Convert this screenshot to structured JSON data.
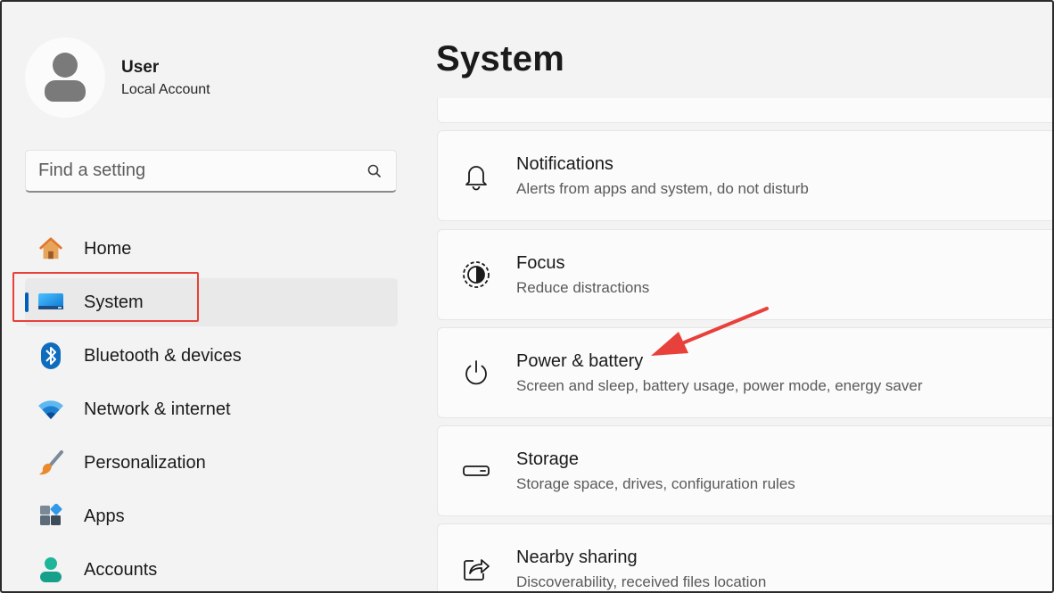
{
  "user": {
    "name": "User",
    "account_type": "Local Account"
  },
  "search": {
    "placeholder": "Find a setting"
  },
  "nav": {
    "items": [
      {
        "label": "Home",
        "icon": "home-icon"
      },
      {
        "label": "System",
        "icon": "system-icon",
        "selected": true
      },
      {
        "label": "Bluetooth & devices",
        "icon": "bluetooth-icon"
      },
      {
        "label": "Network & internet",
        "icon": "wifi-icon"
      },
      {
        "label": "Personalization",
        "icon": "brush-icon"
      },
      {
        "label": "Apps",
        "icon": "apps-icon"
      },
      {
        "label": "Accounts",
        "icon": "person-icon"
      }
    ]
  },
  "main": {
    "title": "System",
    "cards": [
      {
        "title": "Notifications",
        "subtitle": "Alerts from apps and system, do not disturb",
        "icon": "bell-icon"
      },
      {
        "title": "Focus",
        "subtitle": "Reduce distractions",
        "icon": "focus-icon"
      },
      {
        "title": "Power & battery",
        "subtitle": "Screen and sleep, battery usage, power mode, energy saver",
        "icon": "power-icon"
      },
      {
        "title": "Storage",
        "subtitle": "Storage space, drives, configuration rules",
        "icon": "storage-icon"
      },
      {
        "title": "Nearby sharing",
        "subtitle": "Discoverability, received files location",
        "icon": "share-icon"
      }
    ]
  },
  "colors": {
    "accent": "#005fb8",
    "annotation": "#e8403a"
  }
}
